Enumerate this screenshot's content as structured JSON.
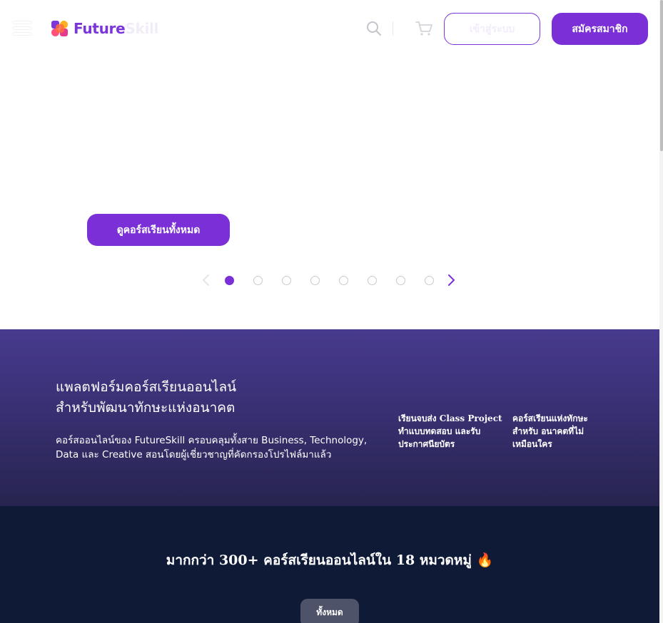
{
  "header": {
    "logo_part1": "Future",
    "logo_part2": "Skill",
    "login_label": "เข้าสู่ระบบ",
    "signup_label": "สมัครสมาชิก",
    "menu_icon": "hamburger-menu-icon",
    "search_icon": "search-icon",
    "cart_icon": "cart-icon"
  },
  "hero": {
    "cta_label": "ดูคอร์สเรียนทั้งหมด",
    "carousel": {
      "slide_count": 8,
      "active_index": 0,
      "prev_icon": "chevron-left-icon",
      "next_icon": "chevron-right-icon"
    }
  },
  "band": {
    "title_line1": "แพลตฟอร์มคอร์สเรียนออนไลน์",
    "title_line2": "สำหรับพัฒนาทักษะแห่งอนาคต",
    "desc_line1": "คอร์สออนไลน์ของ FutureSkill ครอบคลุมทั้งสาย Business, Technology,",
    "desc_line2": "Data และ Creative สอนโดยผู้เชี่ยวชาญที่คัดกรองโปรไฟล์มาแล้ว",
    "features": [
      {
        "lines": [
          "เรียนจบส่ง Class Project",
          "ทำแบบทดสอบ และรับ",
          "ประกาศนียบัตร"
        ]
      },
      {
        "lines": [
          "คอร์สเรียนแห่งทักษะ",
          "สำหรับ อนาคตที่ไม่",
          "เหมือนใคร"
        ]
      }
    ]
  },
  "categories": {
    "heading": "มากกว่า 300+ คอร์สเรียนออนไลน์ใน 18 หมวดหมู่ 🔥",
    "tab_all": "ทั้งหมด"
  },
  "colors": {
    "brand_purple": "#7b2fd6",
    "band_top": "#473a8e",
    "band_bottom": "#27244f",
    "dark_bg": "#0f1a36"
  }
}
